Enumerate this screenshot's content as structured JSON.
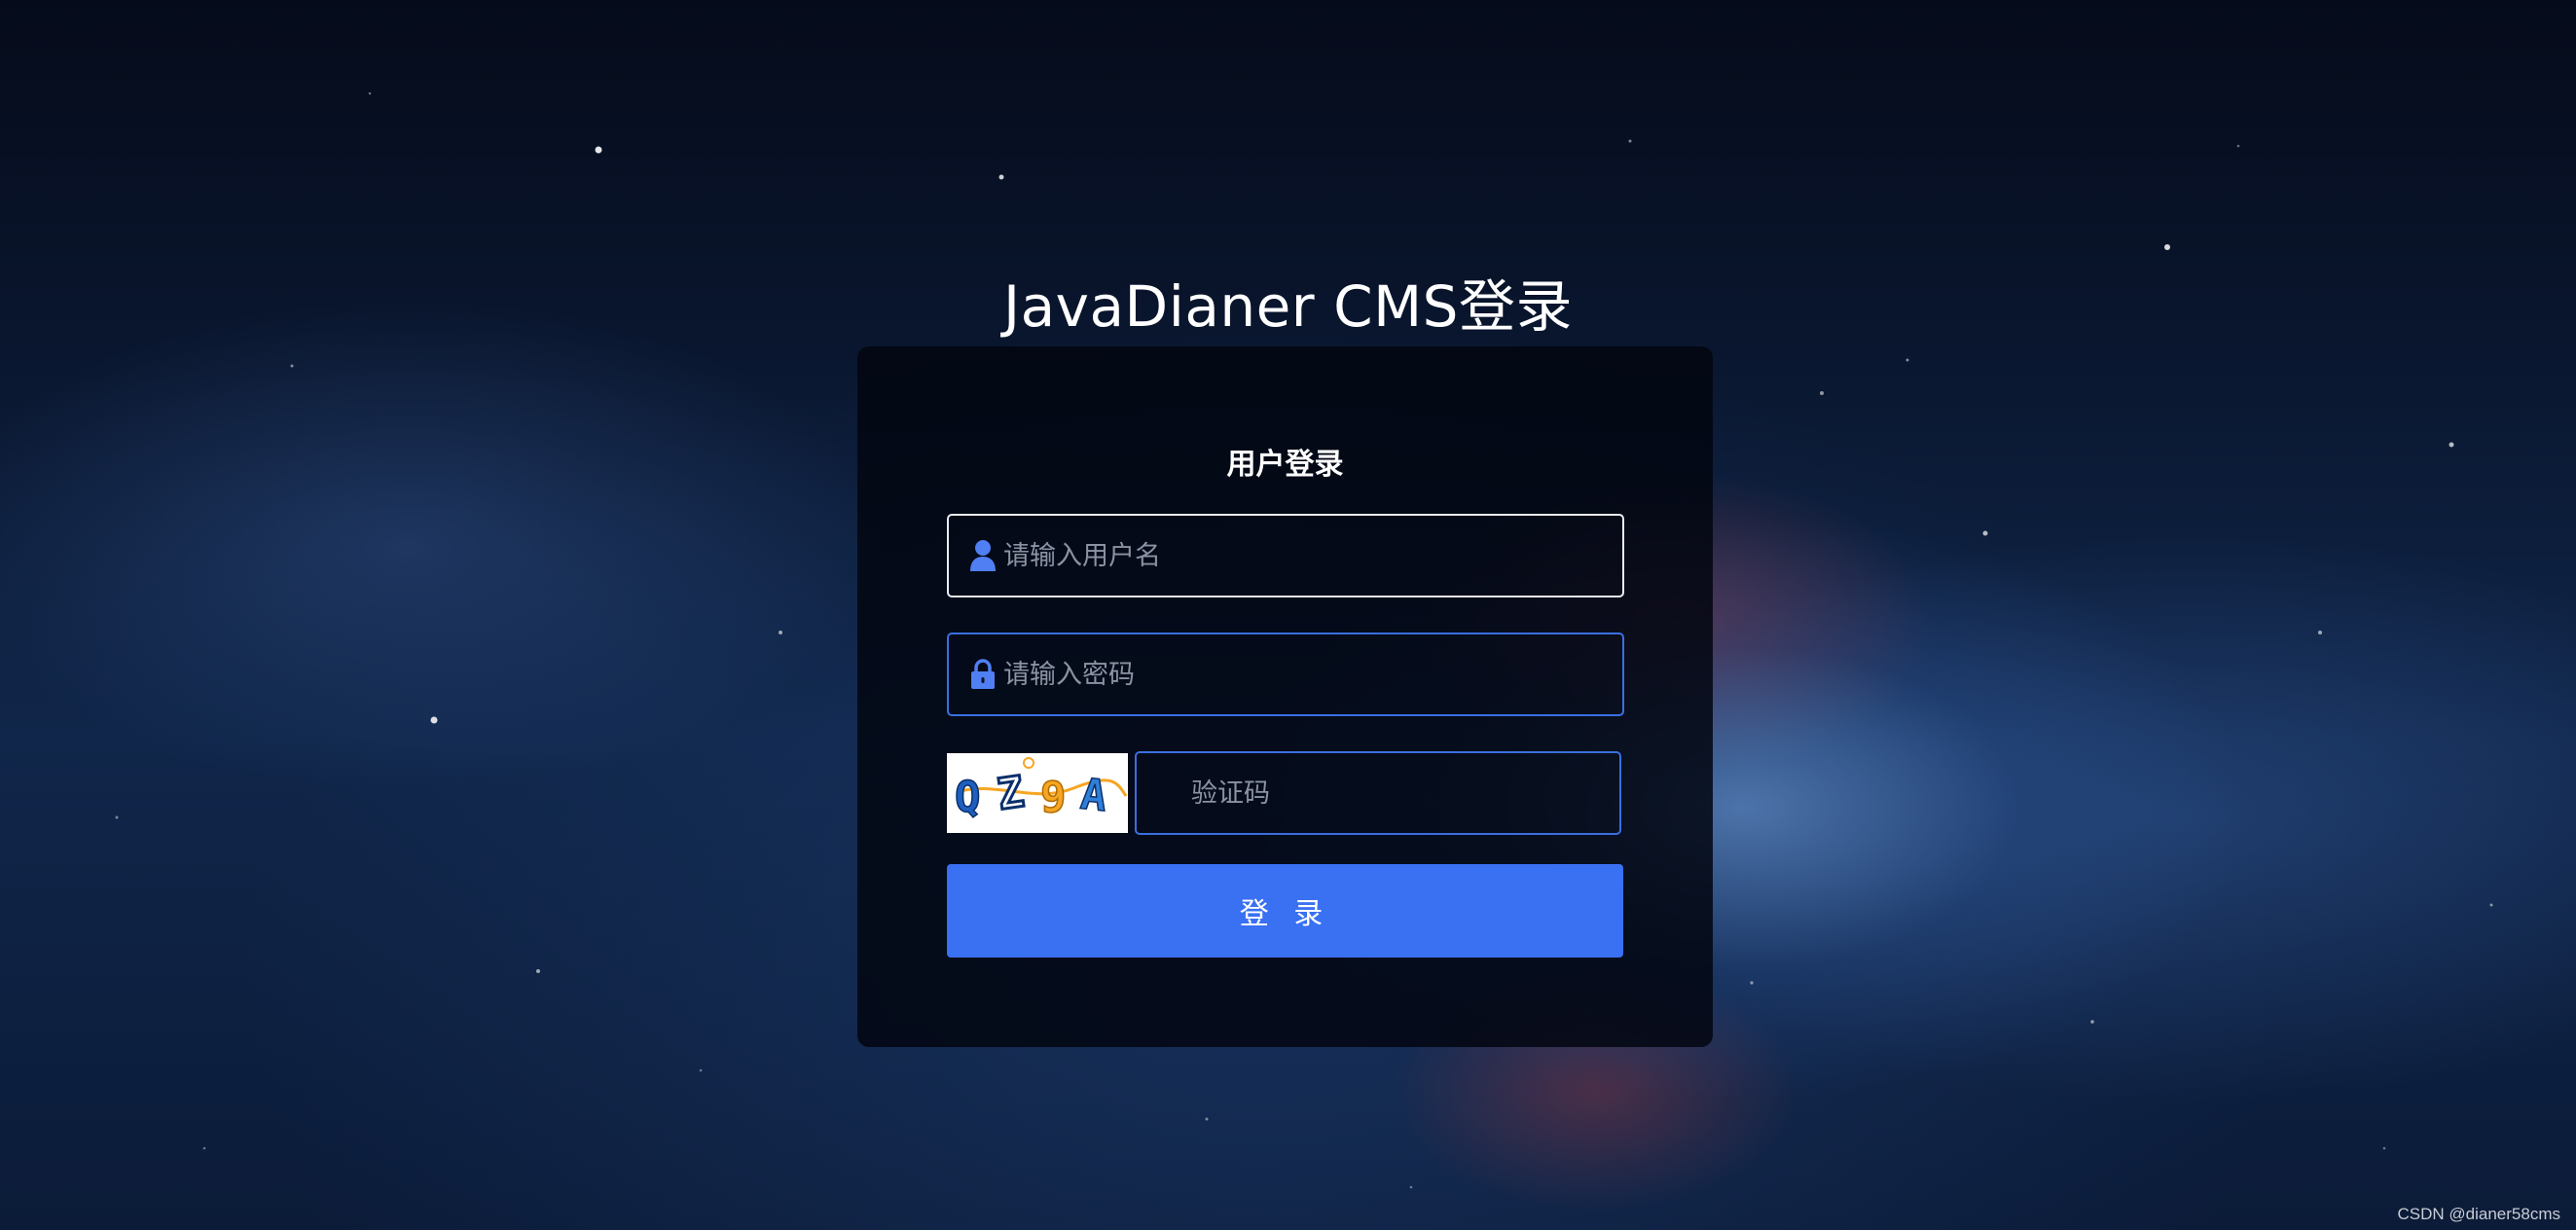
{
  "page": {
    "title": "JavaDianer CMS登录",
    "watermark": "CSDN @dianer58cms"
  },
  "login_card": {
    "heading": "用户登录",
    "username": {
      "placeholder": "请输入用户名",
      "value": "",
      "icon": "user-icon"
    },
    "password": {
      "placeholder": "请输入密码",
      "value": "",
      "icon": "lock-icon"
    },
    "captcha": {
      "image_text": "QZ9A",
      "placeholder": "验证码",
      "value": ""
    },
    "submit_label": "登 录"
  },
  "colors": {
    "accent": "#3a70f2",
    "field_border": "#3b6fe0",
    "focused_border": "#e9ecf2",
    "card_background": "#02060f",
    "icon": "#4f7ff2"
  }
}
